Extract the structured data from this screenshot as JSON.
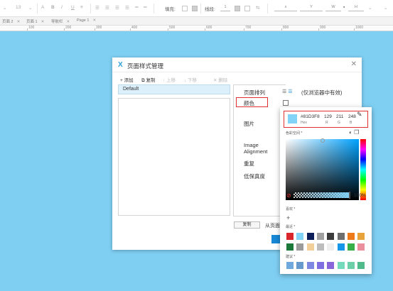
{
  "toolbar": {
    "font_size": "13",
    "fill_label": "填充:",
    "border_label": "线段:",
    "border_value": "1",
    "x_label": "x",
    "y_label": "Y",
    "w_label": "W",
    "h_label": "H"
  },
  "tabs": [
    {
      "label": "页面 2"
    },
    {
      "label": "页面 1"
    },
    {
      "label": "导航栏"
    },
    {
      "label": "Page 1"
    }
  ],
  "ruler": [
    "100",
    "200",
    "300",
    "400",
    "500",
    "600",
    "700",
    "800",
    "900",
    "1000"
  ],
  "dialog": {
    "title": "页面样式管理",
    "close": "✕",
    "actions": [
      {
        "label": "+ 添加",
        "enabled": true
      },
      {
        "label": "⧉ 复制",
        "enabled": true
      },
      {
        "label": "↑ 上移",
        "enabled": false
      },
      {
        "label": "↓ 下移",
        "enabled": false
      },
      {
        "label": "✕ 删除",
        "enabled": false
      }
    ],
    "styles": [
      {
        "name": "Default"
      }
    ],
    "properties": {
      "page_align": "页面排列",
      "align_note": "(仅浏览器中有效)",
      "color": "颜色",
      "image": "图片",
      "image_alignment_1": "Image",
      "image_alignment_2": "Alignment",
      "repeat": "重复",
      "low_fidelity": "低保真度"
    },
    "copy_button": "复制",
    "from_page": "从页面"
  },
  "picker": {
    "hex": "#81D3F8",
    "hex_label": "Hex",
    "r": "129",
    "g": "211",
    "b": "248",
    "r_label": "R",
    "g_label": "G",
    "b_label": "B",
    "color_space_label": "色彩空间 *",
    "alpha": "100%",
    "favorites_label": "喜欢 *",
    "recent_label": "最近 *",
    "suggested_label": "建议 *",
    "colors": {
      "current": "#81D3F8",
      "recent_row1": [
        "#d9262d",
        "#81d3f8",
        "#0c1f5a",
        "#a0a0a0",
        "#3c3c3c",
        "#6e6e6e",
        "#ef7a1a",
        "#e8a43a"
      ],
      "recent_row2": [
        "#1b7a3a",
        "#9b9b9b",
        "#f2cf98",
        "#bdbdbd",
        "#eeeeee",
        "#1497e8",
        "#38b04a",
        "#ec8f9c"
      ],
      "suggested": [
        "#6fa8dc",
        "#6699cc",
        "#7d88e0",
        "#7e6fe0",
        "#8866d9",
        "#75d9bb",
        "#6ccfa8",
        "#4fba8a"
      ]
    }
  }
}
